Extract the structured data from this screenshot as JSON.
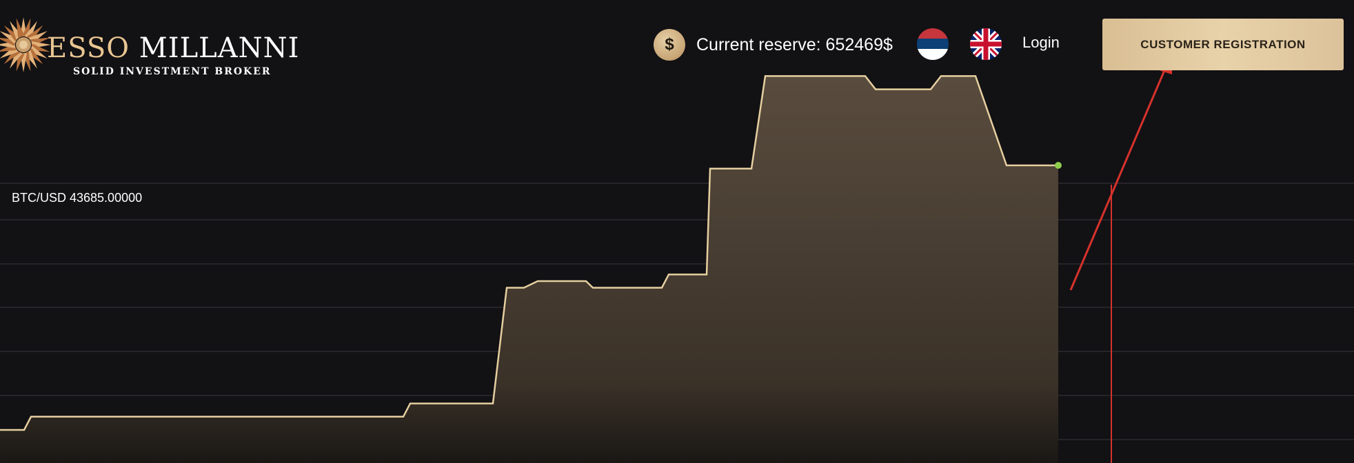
{
  "header": {
    "brand_part1": "ESSO",
    "brand_part2": " MILLANNI",
    "tagline": "SOLID INVESTMENT BROKER",
    "reserve_icon_symbol": "$",
    "reserve_text": "Current reserve: 652469$",
    "flags": [
      {
        "name": "serbia-flag-icon"
      },
      {
        "name": "uk-flag-icon"
      }
    ],
    "login_label": "Login",
    "register_label": "CUSTOMER REGISTRATION"
  },
  "colors": {
    "background": "#121114",
    "accent_gold": "#e9c692",
    "line": "#e6cfa0",
    "area_fill": "#55483a",
    "grid": "#3a383c",
    "current_marker": "#8fcf4d",
    "annotation_red": "#d6322c"
  },
  "chart_data": {
    "type": "area",
    "title": "BTC/USD 43685.00000",
    "x": [
      0,
      35,
      45,
      585,
      595,
      715,
      735,
      760,
      780,
      850,
      860,
      960,
      970,
      1025,
      1030,
      1090,
      1110,
      1185,
      1255,
      1270,
      1350,
      1365,
      1415,
      1460,
      1470,
      1535
    ],
    "values": [
      43645.0,
      43645.0,
      43647.0,
      43647.0,
      43649.0,
      43649.0,
      43666.5,
      43666.5,
      43667.5,
      43667.5,
      43666.5,
      43666.5,
      43668.5,
      43668.5,
      43684.5,
      43684.5,
      43698.5,
      43698.5,
      43698.5,
      43696.5,
      43696.5,
      43698.5,
      43698.5,
      43685.0,
      43685.0,
      43685.0
    ],
    "ylim": [
      43640,
      43710
    ],
    "xlim": [
      0,
      1964
    ],
    "grid": true,
    "current_point_index": 25
  }
}
